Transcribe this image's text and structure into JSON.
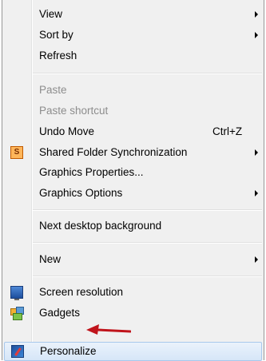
{
  "menu": {
    "items": [
      {
        "label": "View",
        "submenu": true
      },
      {
        "label": "Sort by",
        "submenu": true
      },
      {
        "label": "Refresh"
      },
      {
        "label": "Paste",
        "disabled": true
      },
      {
        "label": "Paste shortcut",
        "disabled": true
      },
      {
        "label": "Undo Move",
        "shortcut": "Ctrl+Z"
      },
      {
        "label": "Shared Folder Synchronization",
        "submenu": true,
        "icon": "shared-folder-sync-icon",
        "icon_glyph": "S"
      },
      {
        "label": "Graphics Properties..."
      },
      {
        "label": "Graphics Options",
        "submenu": true
      },
      {
        "label": "Next desktop background"
      },
      {
        "label": "New",
        "submenu": true
      },
      {
        "label": "Screen resolution",
        "icon": "screen-resolution-icon"
      },
      {
        "label": "Gadgets",
        "icon": "gadgets-icon"
      },
      {
        "label": "Personalize",
        "icon": "personalize-icon",
        "highlighted": true
      }
    ]
  },
  "colors": {
    "menu_background": "#f0f0f0",
    "disabled_text": "#8d8d8d",
    "highlight_border": "#a8c8ec",
    "annotation_arrow": "#c0141b"
  }
}
